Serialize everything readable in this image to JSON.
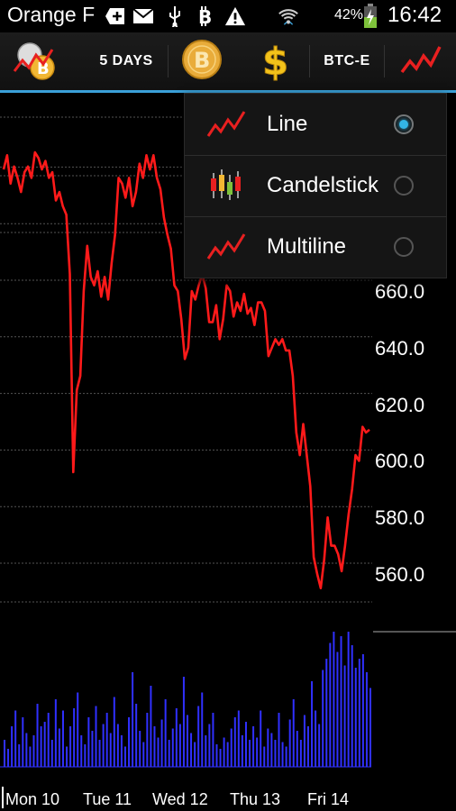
{
  "status_bar": {
    "carrier": "Orange F",
    "battery_percent": "42%",
    "time": "16:42",
    "icons": [
      "plus-box-icon",
      "mail-icon",
      "usb-icon",
      "bitcoin-icon",
      "warning-icon",
      "wifi-icon",
      "battery-charging-icon"
    ]
  },
  "action_bar": {
    "app_icon": "bitcoin-chart-app-icon",
    "period_label": "5 DAYS",
    "currency_icon": "bitcoin-coin-icon",
    "fiat_icon": "dollar-icon",
    "exchange_label": "BTC-E",
    "chart_type_icon": "line-chart-icon"
  },
  "chart_type_menu": {
    "items": [
      {
        "label": "Line",
        "icon": "line-chart-icon",
        "selected": true
      },
      {
        "label": "Candelstick",
        "icon": "candlestick-icon",
        "selected": false
      },
      {
        "label": "Multiline",
        "icon": "multiline-chart-icon",
        "selected": false
      }
    ]
  },
  "colors": {
    "accent": "#33b5e5",
    "price_line": "#ff1a1a",
    "volume_bars": "#3030ff"
  },
  "chart_data": {
    "type": "line",
    "title": "",
    "xlabel": "",
    "ylabel": "",
    "ylim": [
      548,
      715
    ],
    "y_ticks": [
      "560.0",
      "580.0",
      "600.0",
      "620.0",
      "640.0",
      "660.0"
    ],
    "x_ticks": [
      "Mon 10",
      "Tue 11",
      "Wed 12",
      "Thu 13",
      "Fri 14"
    ],
    "grid": true,
    "series": [
      {
        "values": [
          703,
          708,
          698,
          704,
          700,
          695,
          702,
          704,
          700,
          709,
          707,
          703,
          706,
          700,
          702,
          692,
          695,
          690,
          687,
          666,
          596,
          625,
          630,
          660,
          676,
          665,
          662,
          667,
          658,
          665,
          657,
          670,
          680,
          700,
          698,
          693,
          700,
          690,
          695,
          705,
          700,
          708,
          703,
          708,
          700,
          696,
          686,
          680,
          675,
          662,
          660,
          650,
          636,
          640,
          660,
          657,
          662,
          666,
          661,
          649,
          649,
          655,
          643,
          650,
          662,
          660,
          651,
          656,
          653,
          659,
          652,
          654,
          648,
          656,
          656,
          653,
          637,
          640,
          643,
          641,
          643,
          639,
          639,
          630,
          610,
          602,
          613,
          602,
          591,
          566,
          560,
          555,
          565,
          580,
          570,
          570,
          567,
          561,
          570,
          581,
          590,
          602,
          600,
          612,
          610,
          611
        ]
      }
    ],
    "volume": [
      12,
      8,
      18,
      25,
      10,
      22,
      15,
      9,
      14,
      28,
      18,
      20,
      24,
      12,
      30,
      17,
      25,
      9,
      18,
      26,
      33,
      14,
      10,
      22,
      16,
      27,
      12,
      19,
      24,
      15,
      31,
      19,
      14,
      9,
      22,
      42,
      28,
      16,
      11,
      24,
      36,
      18,
      13,
      21,
      30,
      12,
      17,
      26,
      19,
      40,
      23,
      15,
      11,
      27,
      33,
      14,
      19,
      24,
      10,
      8,
      13,
      11,
      17,
      22,
      25,
      14,
      20,
      12,
      18,
      13,
      25,
      9,
      17,
      15,
      12,
      24,
      11,
      9,
      21,
      30,
      16,
      12,
      23,
      18,
      38,
      25,
      19,
      43,
      48,
      55,
      60,
      51,
      58,
      45,
      60,
      54,
      44,
      48,
      50,
      42,
      35
    ]
  }
}
